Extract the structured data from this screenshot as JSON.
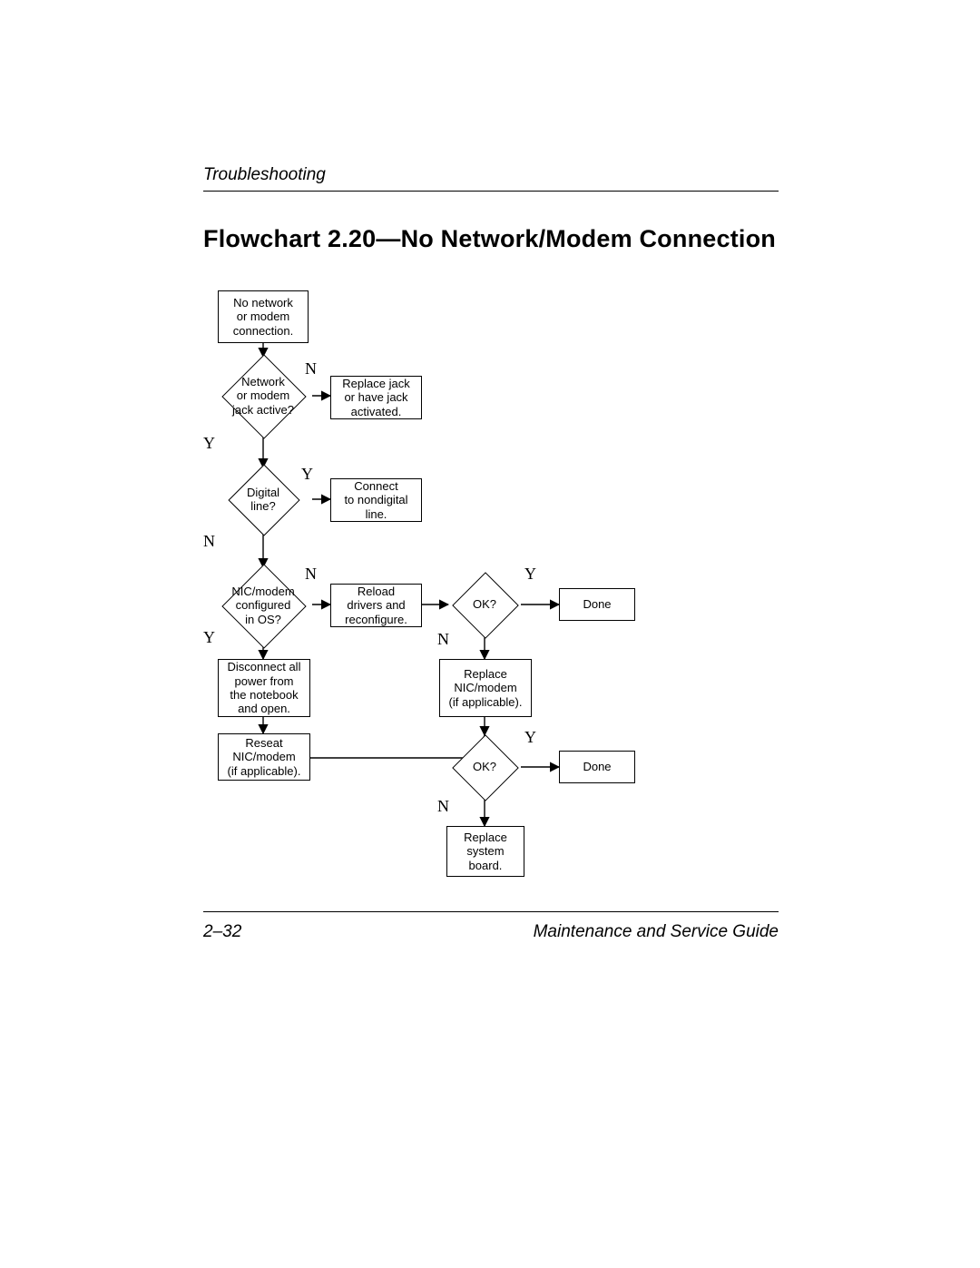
{
  "header": "Troubleshooting",
  "title": "Flowchart 2.20—No Network/Modem Connection",
  "footer_left": "2–32",
  "footer_right": "Maintenance and Service Guide",
  "nodes": {
    "start": "No network\nor modem\nconnection.",
    "d1": "Network\nor modem\njack active?",
    "r1": "Replace jack\nor have jack\nactivated.",
    "d2": "Digital\nline?",
    "r2": "Connect\nto nondigital\nline.",
    "d3": "NIC/modem\nconfigured\nin OS?",
    "r3": "Reload\ndrivers and\nreconfigure.",
    "p4": "Disconnect all\npower from\nthe notebook\nand open.",
    "p5": "Reseat\nNIC/modem\n(if applicable).",
    "d4": "OK?",
    "done1": "Done",
    "p6": "Replace\nNIC/modem\n(if applicable).",
    "d5": "OK?",
    "done2": "Done",
    "p7": "Replace\nsystem\nboard."
  },
  "labels": {
    "Y": "Y",
    "N": "N"
  }
}
